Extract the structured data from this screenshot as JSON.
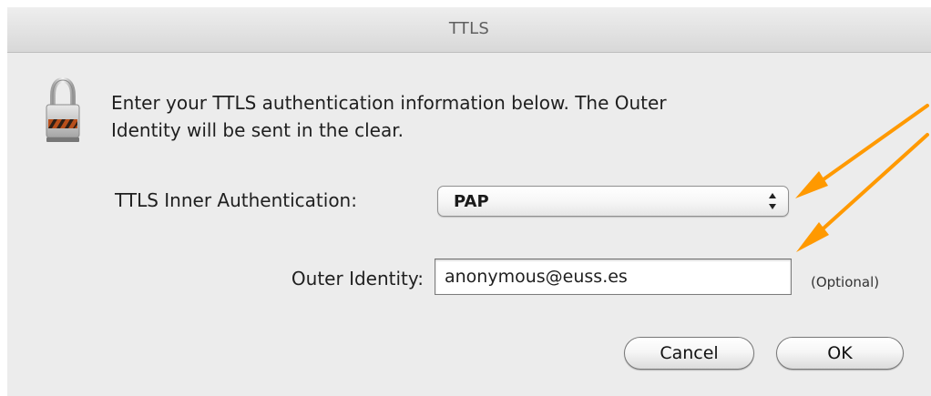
{
  "window": {
    "title": "TTLS"
  },
  "dialog": {
    "message_line_1": "Enter your TTLS authentication information below. The Outer",
    "message_line_2": "Identity will be sent in the clear.",
    "lock_icon": "lock-icon"
  },
  "inner_authentication": {
    "label": "TTLS Inner Authentication:",
    "selected": "PAP",
    "icon": "up-down-arrows-icon"
  },
  "outer_identity": {
    "label": "Outer Identity:",
    "value": "anonymous@euss.es",
    "optional_label": "(Optional)"
  },
  "buttons": {
    "cancel": "Cancel",
    "ok": "OK"
  },
  "annotation": {
    "arrow_color": "#ff9900"
  },
  "colors": {
    "dialog_background": "#ececec",
    "title_text": "#5f5f5f",
    "arrow": "#ff9900"
  }
}
